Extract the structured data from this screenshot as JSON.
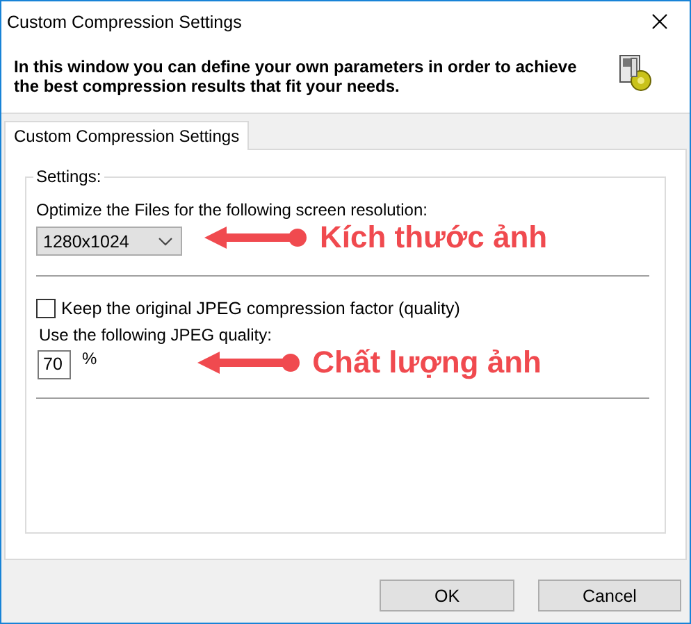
{
  "window": {
    "title": "Custom Compression Settings"
  },
  "header": {
    "text": "In this window you can define your own parameters in order to achieve\nthe best compression results that fit your needs."
  },
  "tabs": [
    {
      "label": "Custom Compression Settings",
      "selected": true
    }
  ],
  "settings": {
    "legend": "Settings:",
    "resolution_label": "Optimize the Files for the following screen resolution:",
    "resolution": "1280x1024",
    "keep_original": {
      "label": "Keep the original JPEG compression factor (quality)",
      "checked": false
    },
    "quality_label": "Use the following JPEG quality:",
    "quality": "70",
    "quality_unit": "%"
  },
  "annotations": [
    {
      "text": "Kích thước ảnh"
    },
    {
      "text": "Chất lượng ảnh"
    }
  ],
  "buttons": [
    {
      "label": "OK"
    },
    {
      "label": "Cancel"
    }
  ]
}
